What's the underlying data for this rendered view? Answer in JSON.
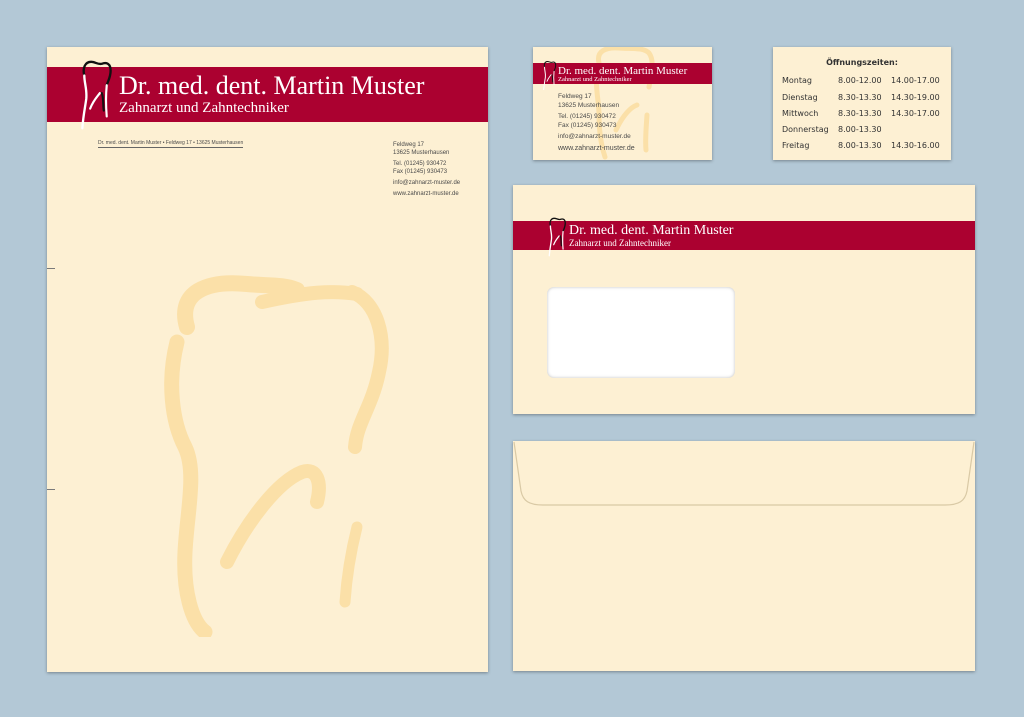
{
  "brand": {
    "name": "Dr. med. dent. Martin Muster",
    "profession": "Zahnarzt und Zahntechniker",
    "band_color": "#ab0130",
    "paper_color": "#fdf0d3",
    "watermark_color": "#fbe0a8",
    "logo_icon": "tooth-icon"
  },
  "letterhead": {
    "return_address": "Dr. med. dent. Martin Muster • Feldweg 17 • 13625 Musterhausen",
    "contact": {
      "street": "Feldweg 17",
      "city": "13625 Musterhausen",
      "tel": "Tel. (01245) 930472",
      "fax": "Fax (01245) 930473",
      "email": "info@zahnarzt-muster.de",
      "web": "www.zahnarzt-muster.de"
    }
  },
  "business_card": {
    "street": "Feldweg 17",
    "city": "13625 Musterhausen",
    "tel": "Tel. (01245) 930472",
    "fax": "Fax (01245) 930473",
    "email": "info@zahnarzt-muster.de",
    "web": "www.zahnarzt-muster.de"
  },
  "hours_card": {
    "title": "Öffnungszeiten:",
    "rows": [
      {
        "day": "Montag",
        "morning": "8.00-12.00",
        "afternoon": "14.00-17.00"
      },
      {
        "day": "Dienstag",
        "morning": "8.30-13.30",
        "afternoon": "14.30-19.00"
      },
      {
        "day": "Mittwoch",
        "morning": "8.30-13.30",
        "afternoon": "14.30-17.00"
      },
      {
        "day": "Donnerstag",
        "morning": "8.00-13.30",
        "afternoon": ""
      },
      {
        "day": "Freitag",
        "morning": "8.00-13.30",
        "afternoon": "14.30-16.00"
      }
    ]
  }
}
